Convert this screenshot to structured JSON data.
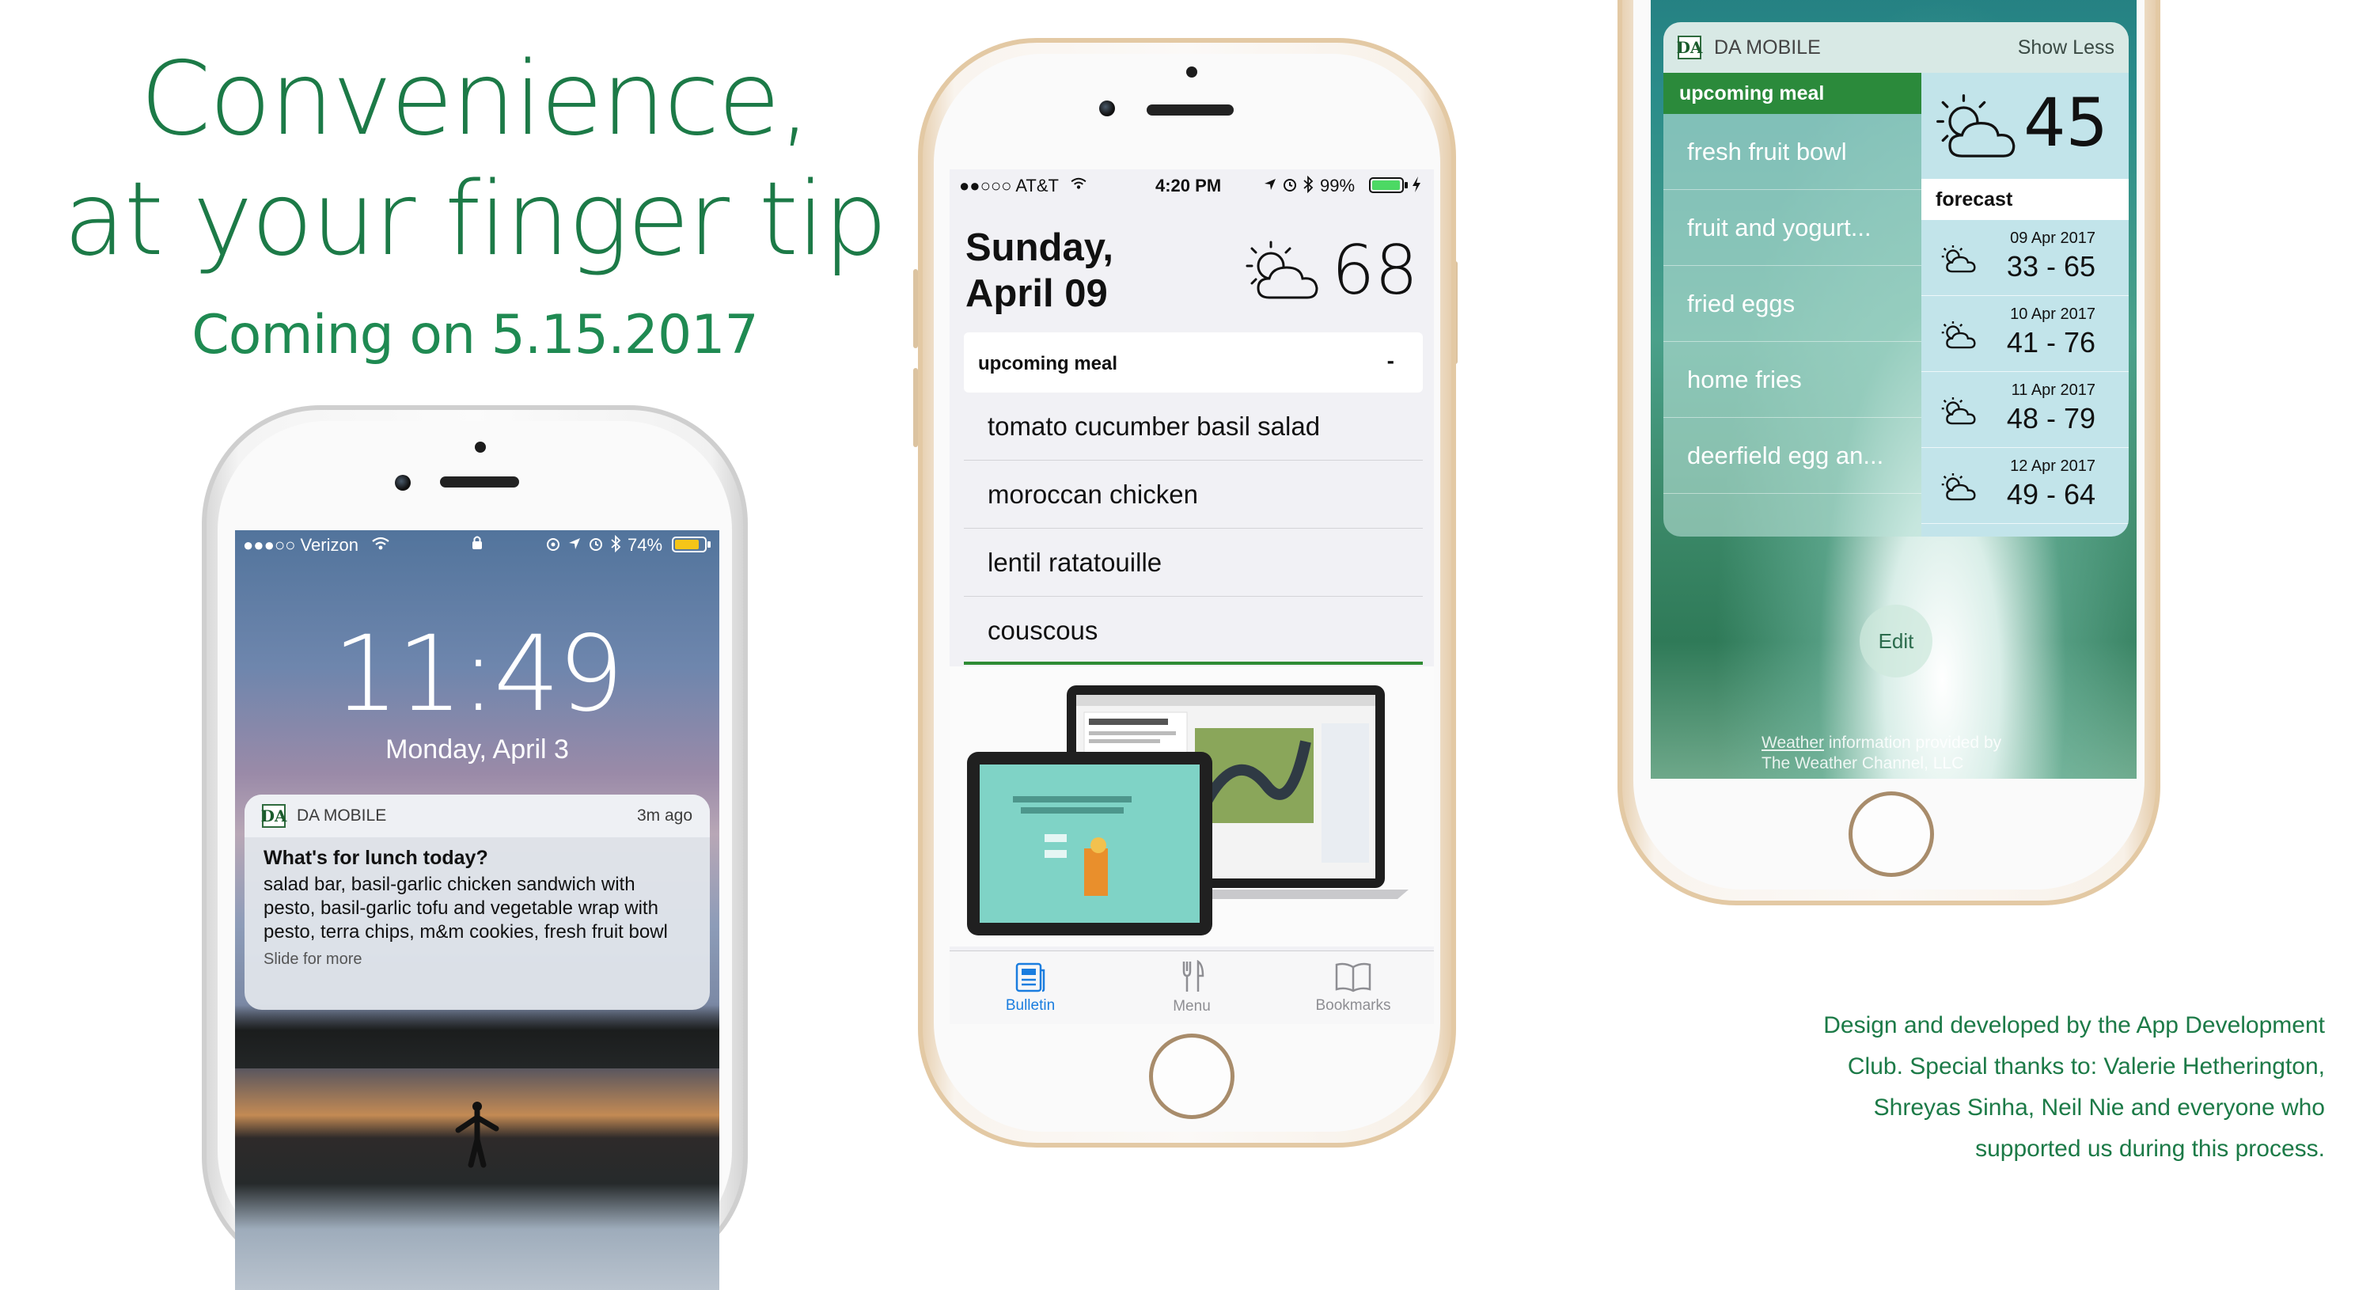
{
  "headline": {
    "line1": "Convenience,",
    "line2": "at your finger tip",
    "line3": "Coming on 5.15.2017"
  },
  "credits": "Design and developed by the App Development Club. Special thanks to: Valerie Hetherington, Shreyas Sinha, Neil Nie and everyone who supported us during this process.",
  "colors": {
    "brand_green": "#1c7a47",
    "accent_green": "#2b8a3b",
    "tab_active": "#1a7ddf"
  },
  "lockscreen": {
    "carrier": "●●●○○ Verizon",
    "battery": "74%",
    "time": "11:49",
    "date": "Monday, April 3",
    "notification": {
      "app": "DA MOBILE",
      "app_logo": "DA",
      "age": "3m ago",
      "title": "What's for lunch today?",
      "body": "salad bar, basil-garlic chicken sandwich with pesto, basil-garlic tofu and vegetable wrap with pesto, terra chips, m&m cookies, fresh fruit bowl",
      "hint": "Slide for more"
    }
  },
  "app": {
    "carrier": "●●○○○ AT&T",
    "time": "4:20 PM",
    "battery": "99%",
    "date_line1": "Sunday,",
    "date_line2": "April 09",
    "temperature": "68",
    "weather_icon": "partly-cloudy-icon",
    "meal_header": "upcoming meal",
    "collapse_symbol": "-",
    "meals": [
      "tomato cucumber basil salad",
      "moroccan chicken",
      "lentil ratatouille",
      "couscous"
    ],
    "tabs": [
      {
        "label": "Bulletin",
        "icon": "bulletin-icon",
        "active": true
      },
      {
        "label": "Menu",
        "icon": "fork-knife-icon",
        "active": false
      },
      {
        "label": "Bookmarks",
        "icon": "book-icon",
        "active": false
      }
    ]
  },
  "widget": {
    "app": "DA MOBILE",
    "toggle": "Show Less",
    "meal_header": "upcoming meal",
    "meals": [
      "fresh fruit bowl",
      "fruit and yogurt...",
      "fried eggs",
      "home fries",
      "deerfield egg an..."
    ],
    "current_temp": "45",
    "forecast_header": "forecast",
    "forecast": [
      {
        "date": "09 Apr 2017",
        "range": "33 - 65"
      },
      {
        "date": "10 Apr 2017",
        "range": "41 - 76"
      },
      {
        "date": "11 Apr 2017",
        "range": "48 - 79"
      },
      {
        "date": "12 Apr 2017",
        "range": "49 - 64"
      }
    ],
    "edit": "Edit",
    "credit_link": "Weather",
    "credit_line1_rest": " information provided by",
    "credit_line2": "The Weather Channel, LLC"
  }
}
